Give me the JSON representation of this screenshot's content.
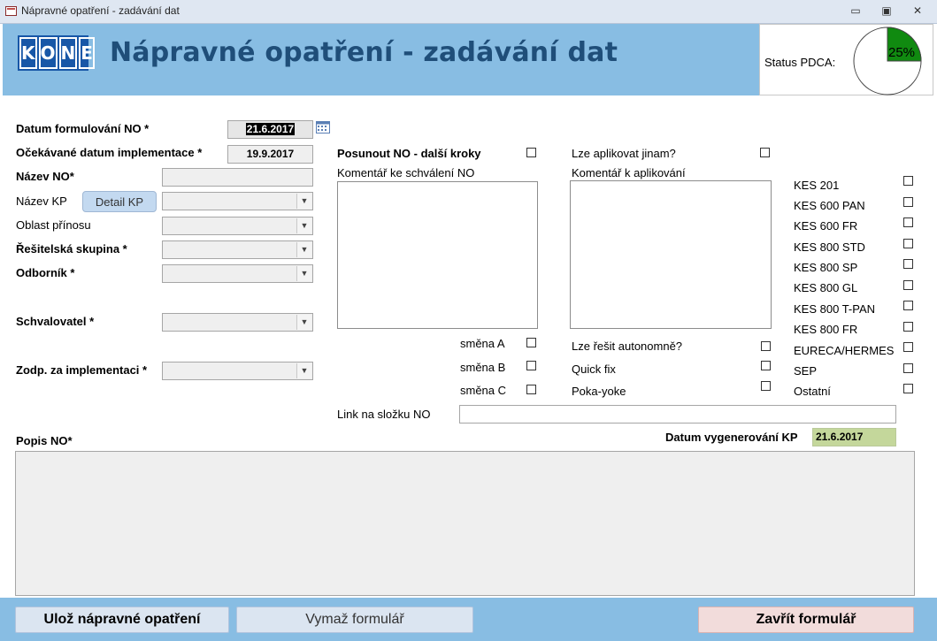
{
  "window": {
    "title": "Nápravné opatření - zadávání dat",
    "minimize": "▭",
    "maximize": "▣",
    "close": "✕"
  },
  "header": {
    "logo_letters": [
      "K",
      "O",
      "N",
      "E"
    ],
    "title": "Nápravné opatření - zadávání dat",
    "status_label": "Status PDCA:",
    "status_percent": "25%",
    "status_fraction": 0.25,
    "status_color": "#108a10"
  },
  "form": {
    "datum_formulovani_label": "Datum formulování NO *",
    "datum_formulovani_value": "21.6.2017",
    "ocekavane_datum_label": "Očekávané datum implementace *",
    "ocekavane_datum_value": "19.9.2017",
    "nazev_no_label": "Název NO*",
    "nazev_kp_label": "Název KP",
    "detail_kp_button": "Detail KP",
    "oblast_label": "Oblast přínosu",
    "resitelska_label": "Řešitelská skupina *",
    "odbornik_label": "Odborník *",
    "schvalovatel_label": "Schvalovatel *",
    "zodp_label": "Zodp. za implementaci *",
    "posunout_label": "Posunout NO - další kroky",
    "komentar_schvaleni_label": "Komentář ke schválení NO",
    "lze_aplikovat_label": "Lze aplikovat jinam?",
    "komentar_aplikovani_label": "Komentář k aplikování",
    "smena_a": "směna A",
    "smena_b": "směna B",
    "smena_c": "směna C",
    "lze_resit_label": "Lze řešit autonomně?",
    "quick_fix_label": "Quick fix",
    "poka_yoke_label": "Poka-yoke",
    "link_label": "Link na složku NO",
    "datum_vygenerovani_label": "Datum vygenerování KP",
    "datum_vygenerovani_value": "21.6.2017",
    "popis_label": "Popis NO*"
  },
  "kes_list": [
    "KES 201",
    "KES 600 PAN",
    "KES 600 FR",
    "KES 800 STD",
    "KES 800 SP",
    "KES 800 GL",
    "KES 800 T-PAN",
    "KES 800 FR",
    "EURECA/HERMES",
    "SEP",
    "Ostatní"
  ],
  "footer": {
    "save_button": "Ulož nápravné opatření",
    "clear_button": "Vymaž formulář",
    "close_button": "Zavřít formulář"
  }
}
